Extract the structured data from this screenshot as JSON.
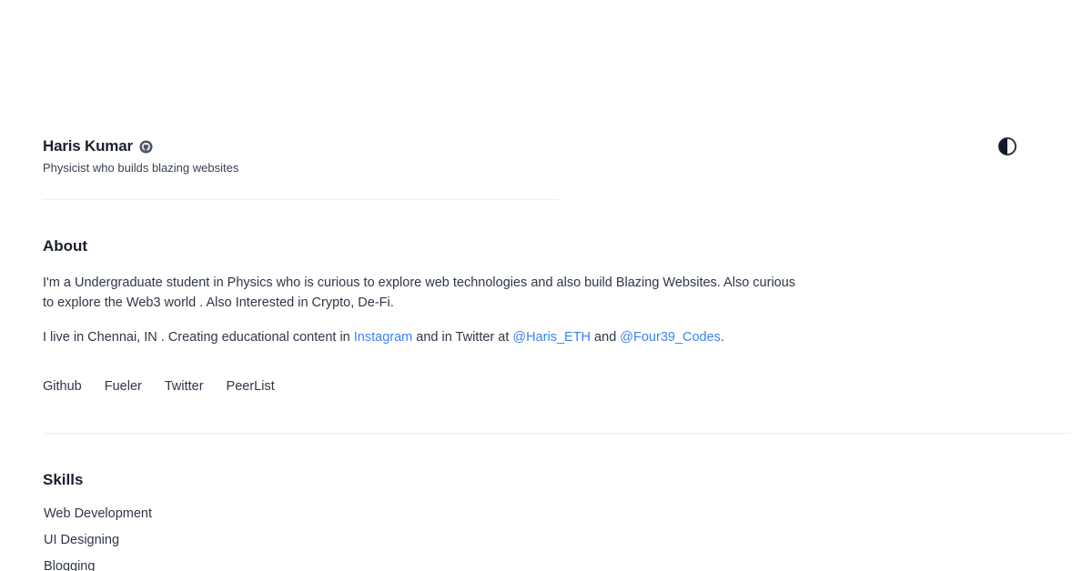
{
  "header": {
    "name": "Haris Kumar",
    "tagline": "Physicist who builds blazing websites",
    "badge_icon": "github-icon",
    "theme_toggle_icon": "contrast-icon"
  },
  "about": {
    "title": "About",
    "p1": "I'm a Undergraduate student in Physics who is curious to explore web technologies and also build Blazing Websites. Also curious to explore the Web3 world . Also Interested in Crypto, De-Fi.",
    "p2_before": "I live in Chennai, IN . Creating educational content in ",
    "instagram": "Instagram",
    "p2_mid": " and in Twitter at ",
    "twitter1": "@Haris_ETH",
    "p2_and": " and ",
    "twitter2": "@Four39_Codes",
    "p2_end": "."
  },
  "social": [
    {
      "label": "Github"
    },
    {
      "label": "Fueler"
    },
    {
      "label": "Twitter"
    },
    {
      "label": "PeerList"
    }
  ],
  "skills": {
    "title": "Skills",
    "items": [
      "Web Development",
      "UI Designing",
      "Blogging"
    ]
  },
  "colors": {
    "link": "#3b82f6",
    "text": "#2d3748",
    "heading": "#1a202c"
  }
}
